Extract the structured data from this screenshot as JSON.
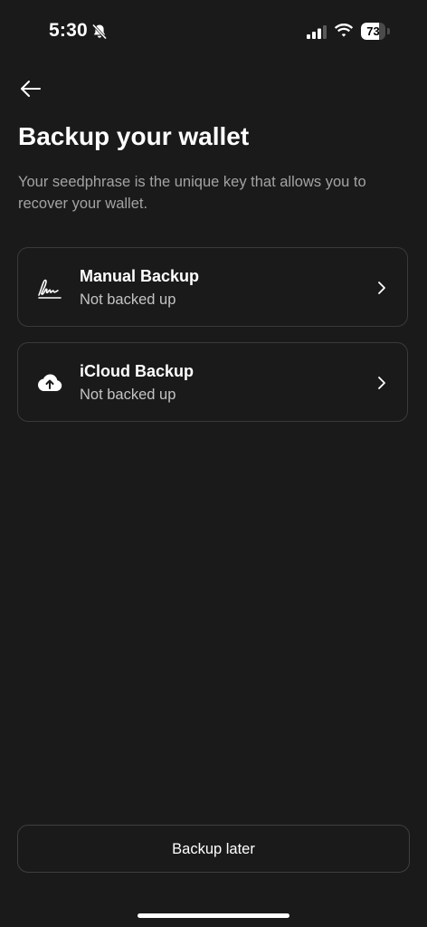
{
  "status_bar": {
    "time": "5:30",
    "battery_level": "73",
    "battery_fraction": 0.73,
    "icons": [
      "bell-slash-icon",
      "cellular-signal-icon",
      "wifi-icon",
      "battery-icon"
    ]
  },
  "header": {
    "back_icon": "arrow-left-icon",
    "title": "Backup your wallet",
    "description": "Your seedphrase is the unique key that allows you to recover your wallet."
  },
  "options": [
    {
      "title": "Manual Backup",
      "subtitle": "Not backed up",
      "icon": "signature-icon"
    },
    {
      "title": "iCloud Backup",
      "subtitle": "Not backed up",
      "icon": "cloud-upload-icon"
    }
  ],
  "footer": {
    "backup_later_label": "Backup later"
  },
  "colors": {
    "background": "#1a1a1a",
    "card_border": "#3a3a3a",
    "text_primary": "#ffffff",
    "text_secondary": "#a3a3a3"
  }
}
